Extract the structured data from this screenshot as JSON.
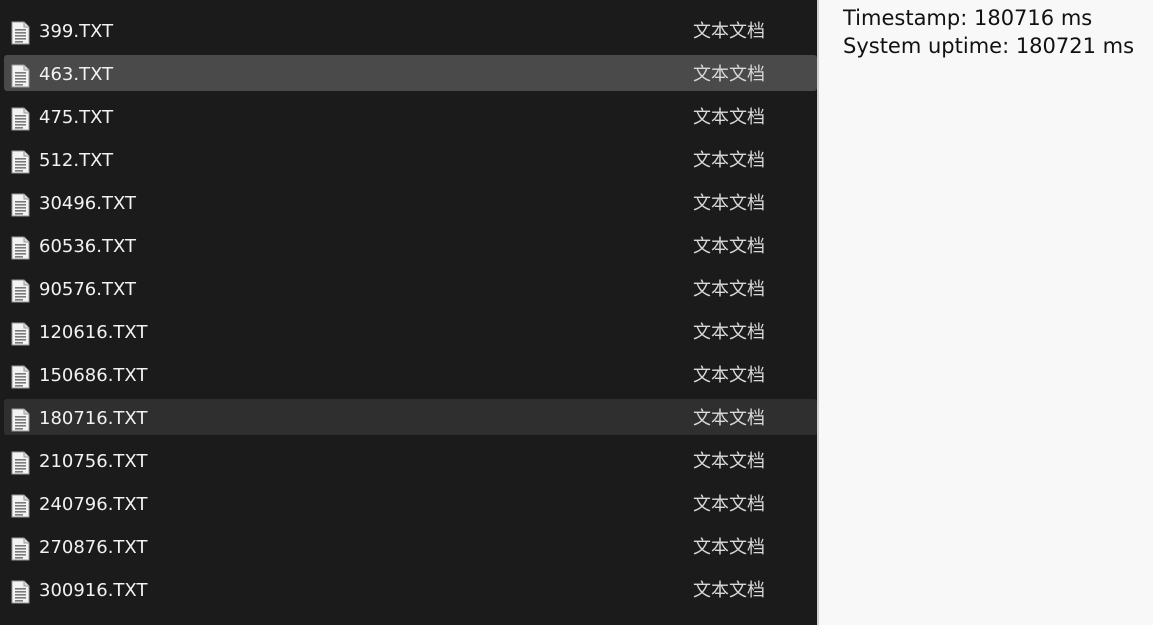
{
  "colors": {
    "pane_background": "#1b1b1b",
    "selected_row": "#4a4a4a",
    "hover_row": "#2f2f2f",
    "info_background": "#f8f8f8"
  },
  "files": [
    {
      "name": "399.TXT",
      "type": "文本文档",
      "icon": "text-file-icon",
      "state": "normal"
    },
    {
      "name": "463.TXT",
      "type": "文本文档",
      "icon": "text-file-icon",
      "state": "selected"
    },
    {
      "name": "475.TXT",
      "type": "文本文档",
      "icon": "text-file-icon",
      "state": "normal"
    },
    {
      "name": "512.TXT",
      "type": "文本文档",
      "icon": "text-file-icon",
      "state": "normal"
    },
    {
      "name": "30496.TXT",
      "type": "文本文档",
      "icon": "text-file-icon",
      "state": "normal"
    },
    {
      "name": "60536.TXT",
      "type": "文本文档",
      "icon": "text-file-icon",
      "state": "normal"
    },
    {
      "name": "90576.TXT",
      "type": "文本文档",
      "icon": "text-file-icon",
      "state": "normal"
    },
    {
      "name": "120616.TXT",
      "type": "文本文档",
      "icon": "text-file-icon",
      "state": "normal"
    },
    {
      "name": "150686.TXT",
      "type": "文本文档",
      "icon": "text-file-icon",
      "state": "normal"
    },
    {
      "name": "180716.TXT",
      "type": "文本文档",
      "icon": "text-file-icon",
      "state": "hover"
    },
    {
      "name": "210756.TXT",
      "type": "文本文档",
      "icon": "text-file-icon",
      "state": "normal"
    },
    {
      "name": "240796.TXT",
      "type": "文本文档",
      "icon": "text-file-icon",
      "state": "normal"
    },
    {
      "name": "270876.TXT",
      "type": "文本文档",
      "icon": "text-file-icon",
      "state": "normal"
    },
    {
      "name": "300916.TXT",
      "type": "文本文档",
      "icon": "text-file-icon",
      "state": "normal"
    }
  ],
  "info": {
    "timestamp_text": "Timestamp: 180716 ms",
    "uptime_text": "System uptime: 180721 ms"
  }
}
